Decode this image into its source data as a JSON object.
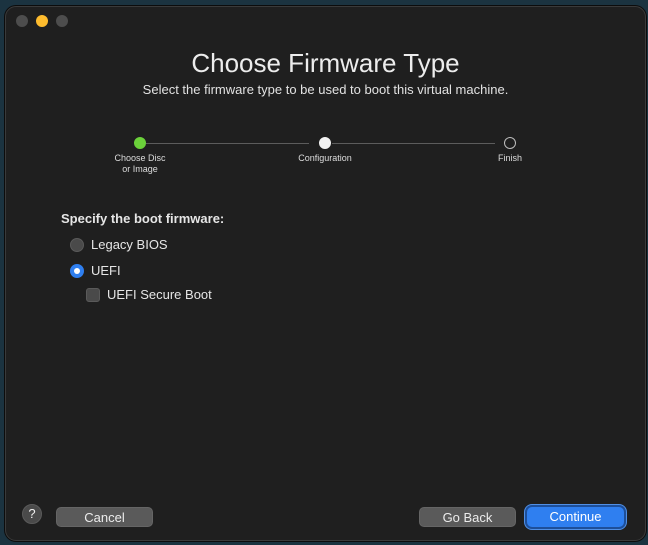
{
  "dialog": {
    "title": "Choose Firmware Type",
    "subtitle": "Select the firmware type to be used to boot this virtual machine."
  },
  "steps": [
    {
      "label_line1": "Choose Disc",
      "label_line2": "or Image",
      "state": "done"
    },
    {
      "label_line1": "Configuration",
      "label_line2": "",
      "state": "current"
    },
    {
      "label_line1": "Finish",
      "label_line2": "",
      "state": "todo"
    }
  ],
  "firmware": {
    "section_label": "Specify the boot firmware:",
    "options": [
      {
        "label": "Legacy BIOS",
        "selected": false
      },
      {
        "label": "UEFI",
        "selected": true
      }
    ],
    "secure_boot": {
      "label": "UEFI Secure Boot",
      "checked": false
    }
  },
  "buttons": {
    "help": "?",
    "cancel": "Cancel",
    "go_back": "Go Back",
    "continue": "Continue"
  },
  "colors": {
    "accent": "#2f7ff0",
    "step_done": "#6bd13a",
    "window_bg": "#1f1f1f"
  }
}
